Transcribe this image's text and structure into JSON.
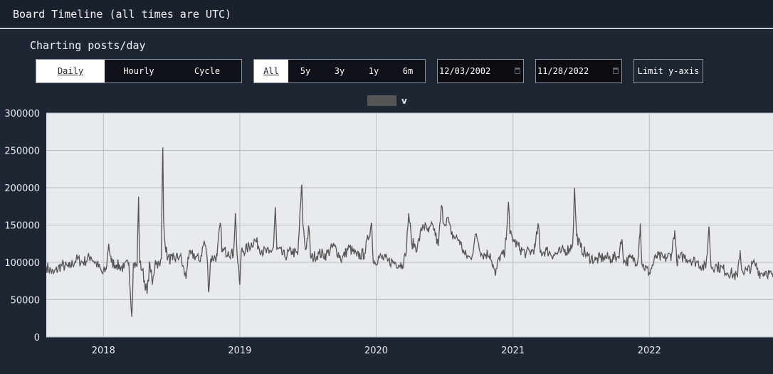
{
  "header": {
    "title": "Board Timeline (all times are UTC)"
  },
  "panel": {
    "subtitle": "Charting posts/day",
    "granularity": {
      "options": [
        "Daily",
        "Hourly",
        "Cycle"
      ],
      "selected": "Daily"
    },
    "range": {
      "options": [
        "All",
        "5y",
        "3y",
        "1y",
        "6m"
      ],
      "selected": "All"
    },
    "start_date": "12/03/2002",
    "end_date": "11/28/2022",
    "limit_button": "Limit y-axis"
  },
  "colors": {
    "page_bg": "#1c2230",
    "plot_bg": "#e8ebee",
    "line": "#555555",
    "grid": "#b9bec5"
  },
  "chart_data": {
    "type": "line",
    "title": "",
    "xlabel": "",
    "ylabel": "",
    "legend": {
      "entries": [
        "v"
      ],
      "placement": "top-center"
    },
    "grid": true,
    "ylim": [
      0,
      300000
    ],
    "yticks": [
      0,
      50000,
      100000,
      150000,
      200000,
      250000,
      300000
    ],
    "xlim": [
      "2017-08-01",
      "2022-11-28"
    ],
    "xticks": [
      "2018",
      "2019",
      "2020",
      "2021",
      "2022"
    ],
    "series": [
      {
        "name": "v",
        "points": [
          [
            "2017-08-01",
            95000
          ],
          [
            "2017-08-20",
            85000
          ],
          [
            "2017-09-10",
            96000
          ],
          [
            "2017-10-01",
            93000
          ],
          [
            "2017-10-20",
            104000
          ],
          [
            "2017-11-08",
            100000
          ],
          [
            "2017-11-28",
            108000
          ],
          [
            "2017-12-15",
            97000
          ],
          [
            "2017-12-30",
            85000
          ],
          [
            "2018-01-08",
            90000
          ],
          [
            "2018-01-15",
            125000
          ],
          [
            "2018-01-22",
            100000
          ],
          [
            "2018-02-05",
            97000
          ],
          [
            "2018-02-25",
            92000
          ],
          [
            "2018-03-10",
            100000
          ],
          [
            "2018-03-18",
            27000
          ],
          [
            "2018-03-22",
            98000
          ],
          [
            "2018-04-01",
            95000
          ],
          [
            "2018-04-05",
            188000
          ],
          [
            "2018-04-08",
            99000
          ],
          [
            "2018-04-15",
            90000
          ],
          [
            "2018-04-28",
            58000
          ],
          [
            "2018-05-05",
            100000
          ],
          [
            "2018-05-12",
            70000
          ],
          [
            "2018-05-20",
            103000
          ],
          [
            "2018-06-01",
            95000
          ],
          [
            "2018-06-05",
            105000
          ],
          [
            "2018-06-08",
            237000
          ],
          [
            "2018-06-09",
            254000
          ],
          [
            "2018-06-11",
            160000
          ],
          [
            "2018-06-15",
            125000
          ],
          [
            "2018-06-22",
            106000
          ],
          [
            "2018-07-05",
            103000
          ],
          [
            "2018-07-25",
            109000
          ],
          [
            "2018-08-10",
            78000
          ],
          [
            "2018-08-15",
            107000
          ],
          [
            "2018-09-01",
            110000
          ],
          [
            "2018-09-15",
            102000
          ],
          [
            "2018-09-28",
            128000
          ],
          [
            "2018-10-05",
            110000
          ],
          [
            "2018-10-10",
            60000
          ],
          [
            "2018-10-15",
            105000
          ],
          [
            "2018-11-01",
            108000
          ],
          [
            "2018-11-10",
            153000
          ],
          [
            "2018-11-15",
            114000
          ],
          [
            "2018-12-01",
            115000
          ],
          [
            "2018-12-15",
            110000
          ],
          [
            "2018-12-20",
            166000
          ],
          [
            "2018-12-25",
            110000
          ],
          [
            "2019-01-01",
            70000
          ],
          [
            "2019-01-05",
            115000
          ],
          [
            "2019-01-20",
            118000
          ],
          [
            "2019-02-10",
            130000
          ],
          [
            "2019-03-01",
            116000
          ],
          [
            "2019-03-20",
            112000
          ],
          [
            "2019-04-01",
            120000
          ],
          [
            "2019-04-06",
            174000
          ],
          [
            "2019-04-10",
            118000
          ],
          [
            "2019-05-01",
            108000
          ],
          [
            "2019-05-20",
            115000
          ],
          [
            "2019-06-05",
            110000
          ],
          [
            "2019-06-16",
            204000
          ],
          [
            "2019-06-19",
            150000
          ],
          [
            "2019-06-26",
            117000
          ],
          [
            "2019-07-05",
            146000
          ],
          [
            "2019-07-10",
            105000
          ],
          [
            "2019-08-01",
            112000
          ],
          [
            "2019-08-20",
            110000
          ],
          [
            "2019-09-10",
            122000
          ],
          [
            "2019-10-01",
            104000
          ],
          [
            "2019-10-20",
            120000
          ],
          [
            "2019-11-10",
            108000
          ],
          [
            "2019-12-01",
            112000
          ],
          [
            "2019-12-20",
            153000
          ],
          [
            "2019-12-24",
            100000
          ],
          [
            "2020-01-10",
            107000
          ],
          [
            "2020-02-01",
            102000
          ],
          [
            "2020-02-20",
            100000
          ],
          [
            "2020-03-10",
            97000
          ],
          [
            "2020-03-20",
            108000
          ],
          [
            "2020-03-28",
            166000
          ],
          [
            "2020-04-05",
            126000
          ],
          [
            "2020-04-20",
            120000
          ],
          [
            "2020-05-05",
            151000
          ],
          [
            "2020-05-20",
            140000
          ],
          [
            "2020-06-01",
            150000
          ],
          [
            "2020-06-15",
            122000
          ],
          [
            "2020-06-24",
            176000
          ],
          [
            "2020-06-30",
            152000
          ],
          [
            "2020-07-10",
            160000
          ],
          [
            "2020-07-20",
            137000
          ],
          [
            "2020-08-10",
            130000
          ],
          [
            "2020-08-25",
            110000
          ],
          [
            "2020-09-10",
            105000
          ],
          [
            "2020-09-25",
            138000
          ],
          [
            "2020-10-10",
            110000
          ],
          [
            "2020-11-01",
            112000
          ],
          [
            "2020-11-15",
            82000
          ],
          [
            "2020-11-25",
            107000
          ],
          [
            "2020-12-10",
            110000
          ],
          [
            "2020-12-20",
            181000
          ],
          [
            "2020-12-24",
            138000
          ],
          [
            "2021-01-05",
            128000
          ],
          [
            "2021-01-20",
            118000
          ],
          [
            "2021-02-05",
            112000
          ],
          [
            "2021-02-20",
            115000
          ],
          [
            "2021-03-01",
            120000
          ],
          [
            "2021-03-10",
            151000
          ],
          [
            "2021-03-15",
            113000
          ],
          [
            "2021-04-01",
            116000
          ],
          [
            "2021-04-20",
            110000
          ],
          [
            "2021-05-10",
            114000
          ],
          [
            "2021-06-01",
            118000
          ],
          [
            "2021-06-10",
            126000
          ],
          [
            "2021-06-15",
            200000
          ],
          [
            "2021-06-20",
            136000
          ],
          [
            "2021-07-01",
            120000
          ],
          [
            "2021-07-20",
            108000
          ],
          [
            "2021-08-10",
            103000
          ],
          [
            "2021-09-01",
            107000
          ],
          [
            "2021-09-20",
            105000
          ],
          [
            "2021-10-10",
            108000
          ],
          [
            "2021-10-20",
            131000
          ],
          [
            "2021-10-25",
            100000
          ],
          [
            "2021-11-15",
            105000
          ],
          [
            "2021-12-01",
            102000
          ],
          [
            "2021-12-08",
            152000
          ],
          [
            "2021-12-12",
            98000
          ],
          [
            "2022-01-01",
            86000
          ],
          [
            "2022-01-20",
            108000
          ],
          [
            "2022-02-10",
            105000
          ],
          [
            "2022-03-01",
            110000
          ],
          [
            "2022-03-10",
            143000
          ],
          [
            "2022-03-15",
            102000
          ],
          [
            "2022-04-01",
            108000
          ],
          [
            "2022-04-20",
            104000
          ],
          [
            "2022-05-10",
            100000
          ],
          [
            "2022-06-01",
            92000
          ],
          [
            "2022-06-10",
            148000
          ],
          [
            "2022-06-15",
            95000
          ],
          [
            "2022-07-01",
            95000
          ],
          [
            "2022-07-20",
            90000
          ],
          [
            "2022-08-10",
            85000
          ],
          [
            "2022-08-25",
            80000
          ],
          [
            "2022-09-01",
            116000
          ],
          [
            "2022-09-05",
            90000
          ],
          [
            "2022-09-20",
            88000
          ],
          [
            "2022-10-10",
            99000
          ],
          [
            "2022-10-25",
            85000
          ],
          [
            "2022-11-10",
            88000
          ],
          [
            "2022-11-28",
            80000
          ]
        ]
      }
    ]
  }
}
